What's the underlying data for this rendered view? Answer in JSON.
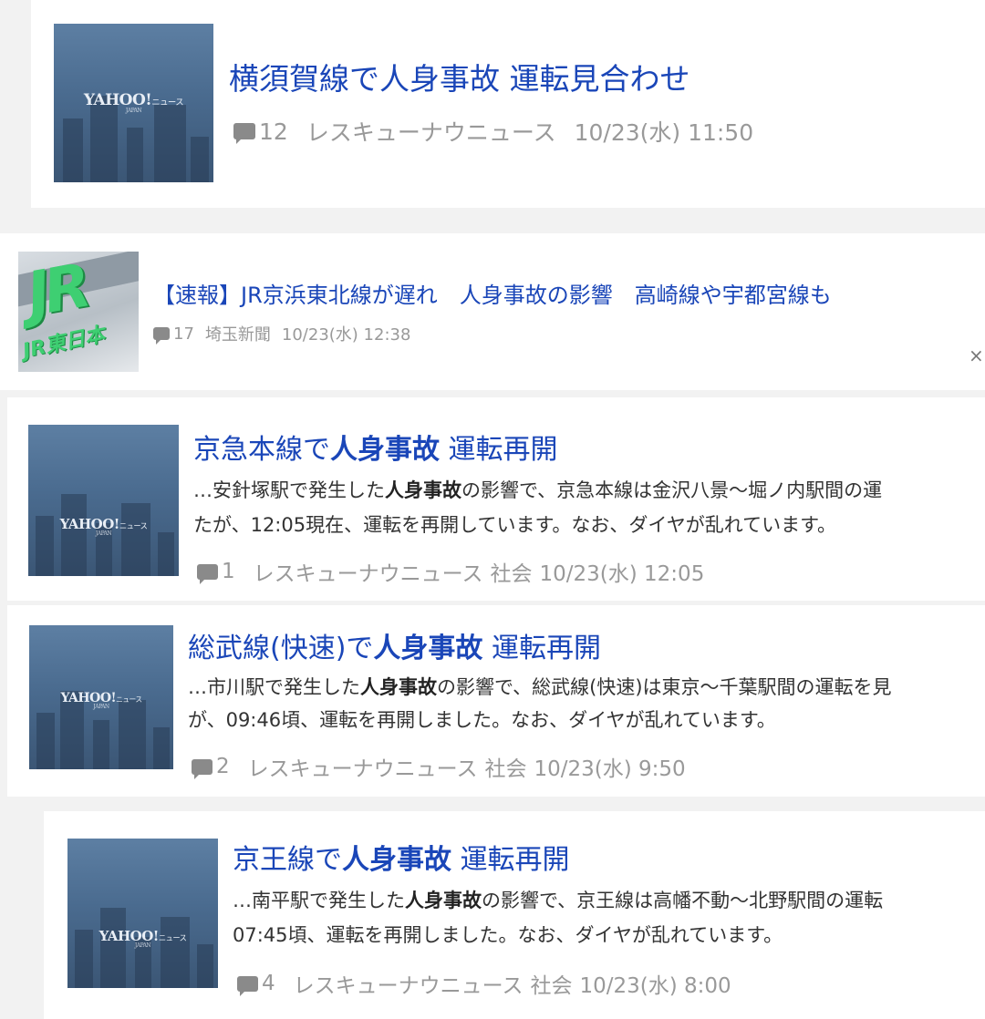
{
  "articles": [
    {
      "title": "横須賀線で人身事故 運転見合わせ",
      "comments": "12",
      "source": "レスキューナウニュース",
      "datetime": "10/23(水) 11:50"
    },
    {
      "title": "【速報】JR京浜東北線が遅れ　人身事故の影響　高崎線や宇都宮線も",
      "comments": "17",
      "source": "埼玉新聞",
      "datetime": "10/23(水) 12:38",
      "close": "×",
      "thumb_text": [
        "JR",
        "JR東日本"
      ]
    },
    {
      "title_pre": "京急本線で",
      "title_bold": "人身事故",
      "title_post": " 運転再開",
      "snippet1_pre": "…安針塚駅で発生した",
      "snippet1_bold": "人身事故",
      "snippet1_post": "の影響で、京急本線は金沢八景～堀ノ内駅間の運",
      "snippet2": "たが、12:05現在、運転を再開しています。なお、ダイヤが乱れています。",
      "comments": "1",
      "source": "レスキューナウニュース",
      "category": "社会",
      "datetime": "10/23(水) 12:05"
    },
    {
      "title_pre": "総武線(快速)で",
      "title_bold": "人身事故",
      "title_post": " 運転再開",
      "snippet1_pre": "…市川駅で発生した",
      "snippet1_bold": "人身事故",
      "snippet1_post": "の影響で、総武線(快速)は東京～千葉駅間の運転を見",
      "snippet2": "が、09:46頃、運転を再開しました。なお、ダイヤが乱れています。",
      "comments": "2",
      "source": "レスキューナウニュース",
      "category": "社会",
      "datetime": "10/23(水) 9:50"
    },
    {
      "title_pre": "京王線で",
      "title_bold": "人身事故",
      "title_post": " 運転再開",
      "snippet1_pre": "…南平駅で発生した",
      "snippet1_bold": "人身事故",
      "snippet1_post": "の影響で、京王線は高幡不動～北野駅間の運転",
      "snippet2": "07:45頃、運転を再開しました。なお、ダイヤが乱れています。",
      "comments": "4",
      "source": "レスキューナウニュース",
      "category": "社会",
      "datetime": "10/23(水) 8:00"
    }
  ],
  "thumb_logo": {
    "main": "YAHOO!",
    "sub": "ニュース",
    "small": "JAPAN"
  },
  "colors": {
    "title": "#1a46b8",
    "meta": "#999999",
    "background": "#f2f2f2",
    "card": "#ffffff"
  }
}
